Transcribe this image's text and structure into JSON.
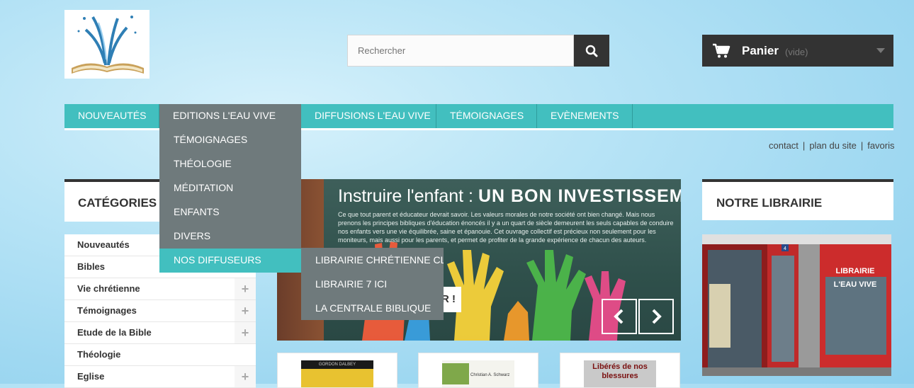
{
  "search": {
    "placeholder": "Rechercher"
  },
  "cart": {
    "title": "Panier",
    "status": "(vide)"
  },
  "menu": {
    "items": [
      {
        "label": "NOUVEAUTÉS"
      },
      {
        "label": "EDITIONS L'EAU VIVE"
      },
      {
        "label": "DIFFUSIONS L'EAU VIVE"
      },
      {
        "label": "TÉMOIGNAGES"
      },
      {
        "label": "EVÈNEMENTS"
      }
    ]
  },
  "dropdown": {
    "items": [
      {
        "label": "TÉMOIGNAGES"
      },
      {
        "label": "THÉOLOGIE"
      },
      {
        "label": "MÉDITATION"
      },
      {
        "label": "ENFANTS"
      },
      {
        "label": "DIVERS"
      },
      {
        "label": "NOS DIFFUSEURS"
      }
    ],
    "submenu": [
      {
        "label": "LIBRAIRIE CHRÉTIENNE CLC"
      },
      {
        "label": "LIBRAIRIE 7 ICI"
      },
      {
        "label": "LA CENTRALE BIBLIQUE"
      }
    ]
  },
  "toplinks": {
    "contact": "contact",
    "sitemap": "plan du site",
    "favorites": "favoris"
  },
  "categories": {
    "title": "CATÉGORIES",
    "items": [
      {
        "label": "Nouveautés"
      },
      {
        "label": "Bibles"
      },
      {
        "label": "Vie chrétienne"
      },
      {
        "label": "Témoignages"
      },
      {
        "label": "Etude de la Bible"
      },
      {
        "label": "Théologie"
      },
      {
        "label": "Eglise"
      }
    ]
  },
  "slider": {
    "title_light": "Instruire l'enfant : ",
    "title_bold": "UN BON INVESTISSEMENT",
    "body": "Ce que tout parent et éducateur devrait savoir. Les valeurs morales de notre société ont bien changé. Mais nous prenons les principes bibliques d'éducation énoncés il y a un quart de siècle demeurent les seuls capables de conduire nos enfants vers une vie équilibrée, saine et épanouie. Cet ouvrage collectif est précieux non seulement pour les moniteurs, mais aussi pour les parents, et permet de profiter de la grande expérience de chacun des auteurs.",
    "button": "R !"
  },
  "store": {
    "title": "NOTRE LIBRAIRIE",
    "sign": "LIBRAIRIE L'EAU VIVE",
    "number": "4"
  },
  "products": [
    {
      "cover_text": "GORDON DALBEY"
    },
    {
      "cover_text": "Christian A. Schwarz"
    },
    {
      "cover_text": "Libérés de nos blessures"
    }
  ],
  "colors": {
    "menu": "#42bfbf",
    "dropdown": "#6f7a7c",
    "dark": "#333333"
  }
}
